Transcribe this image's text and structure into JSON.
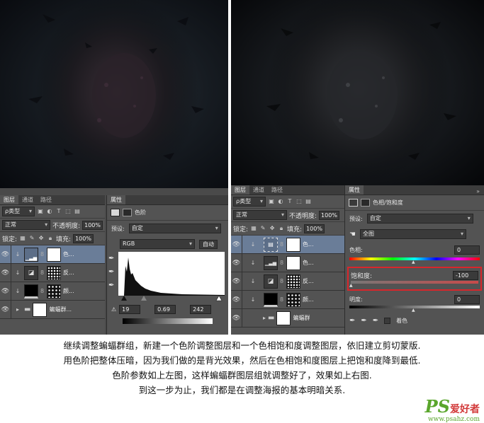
{
  "left_panel": {
    "layers": {
      "tabs": [
        "图层",
        "通道",
        "路径"
      ],
      "filter_label": "ρ类型",
      "blend_mode": "正常",
      "opacity_label": "不透明度:",
      "opacity_value": "100%",
      "lock_label": "锁定:",
      "fill_label": "填充:",
      "fill_value": "100%",
      "items": [
        {
          "name": "色...",
          "icon": "levels-icon"
        },
        {
          "name": "反...",
          "icon": "invert-icon"
        },
        {
          "name": "颜...",
          "icon": "color-fill-icon"
        },
        {
          "name": "蝙蝠群...",
          "icon": "folder-icon"
        }
      ]
    },
    "properties": {
      "tab": "属性",
      "title": "色阶",
      "preset_label": "预设:",
      "preset_value": "自定",
      "channel": "RGB",
      "auto_button": "自动",
      "input_black": "19",
      "input_gamma": "0.69",
      "input_white": "242"
    }
  },
  "right_panel": {
    "layers": {
      "tabs": [
        "图层",
        "通道",
        "路径"
      ],
      "filter_label": "ρ类型",
      "blend_mode": "正常",
      "opacity_label": "不透明度:",
      "opacity_value": "100%",
      "lock_label": "锁定:",
      "fill_label": "填充:",
      "fill_value": "100%",
      "items": [
        {
          "name": "色...",
          "icon": "hue-saturation-icon"
        },
        {
          "name": "色...",
          "icon": "levels-icon"
        },
        {
          "name": "反...",
          "icon": "invert-icon"
        },
        {
          "name": "颜...",
          "icon": "color-fill-icon"
        },
        {
          "name": "蝙蝠群",
          "icon": "folder-icon"
        }
      ]
    },
    "properties": {
      "tab": "属性",
      "title": "色相/饱和度",
      "preset_label": "预设:",
      "preset_value": "自定",
      "range_value": "全图",
      "hue_label": "色相:",
      "hue_value": "0",
      "saturation_label": "饱和度:",
      "saturation_value": "-100",
      "lightness_label": "明度:",
      "lightness_value": "0",
      "colorize_label": "着色",
      "highlight_color": "#d8262b"
    }
  },
  "caption": [
    "继续调整蝙蝠群组，新建一个色阶调整图层和一个色相饱和度调整图层，依旧建立剪切蒙版.",
    "用色阶把整体压暗，因为我们做的是背光效果，然后在色相饱和度图层上把饱和度降到最低.",
    "色阶参数如上左图，这样蝙蝠群图层组就调整好了，效果如上右图.",
    "到这一步为止，我们都是在调整海报的基本明暗关系."
  ],
  "watermark": {
    "ps": "PS",
    "cn": "爱好者",
    "url": "www.psahz.com"
  }
}
